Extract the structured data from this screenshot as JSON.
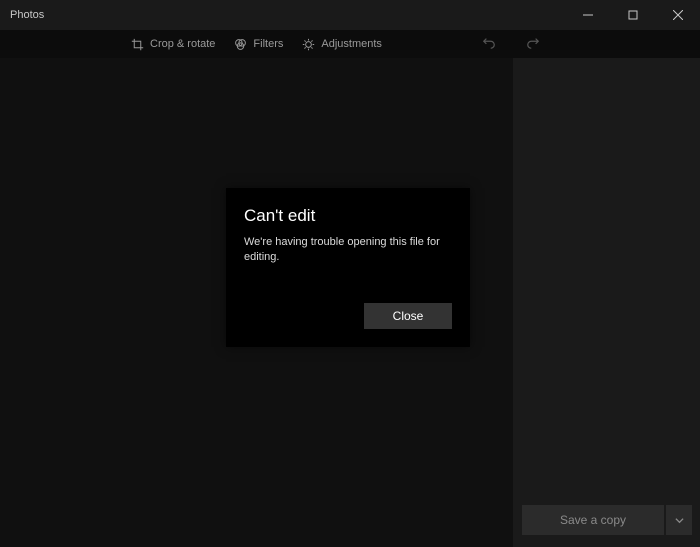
{
  "app": {
    "title": "Photos"
  },
  "toolbar": {
    "crop": "Crop & rotate",
    "filters": "Filters",
    "adjustments": "Adjustments"
  },
  "dialog": {
    "title": "Can't edit",
    "message": "We're having trouble opening this file for editing.",
    "close_label": "Close"
  },
  "footer": {
    "save_label": "Save a copy"
  }
}
